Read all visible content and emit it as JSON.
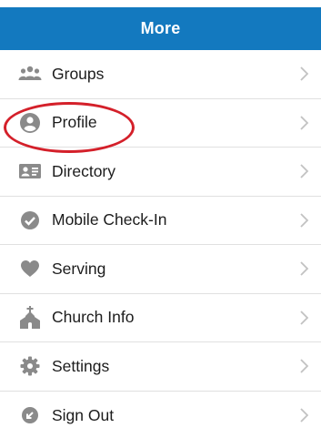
{
  "header": {
    "title": "More",
    "background": "#1379bf"
  },
  "menu": {
    "items": [
      {
        "label": "Groups",
        "icon": "groups-icon"
      },
      {
        "label": "Profile",
        "icon": "profile-icon"
      },
      {
        "label": "Directory",
        "icon": "directory-icon"
      },
      {
        "label": "Mobile Check-In",
        "icon": "checkmark-circle-icon"
      },
      {
        "label": "Serving",
        "icon": "heart-icon"
      },
      {
        "label": "Church Info",
        "icon": "church-icon"
      },
      {
        "label": "Settings",
        "icon": "gear-icon"
      },
      {
        "label": "Sign Out",
        "icon": "sign-out-icon"
      }
    ]
  },
  "colors": {
    "icon": "#8a8a8a",
    "chevron": "#c2c2c2",
    "highlight": "#d4202a"
  }
}
